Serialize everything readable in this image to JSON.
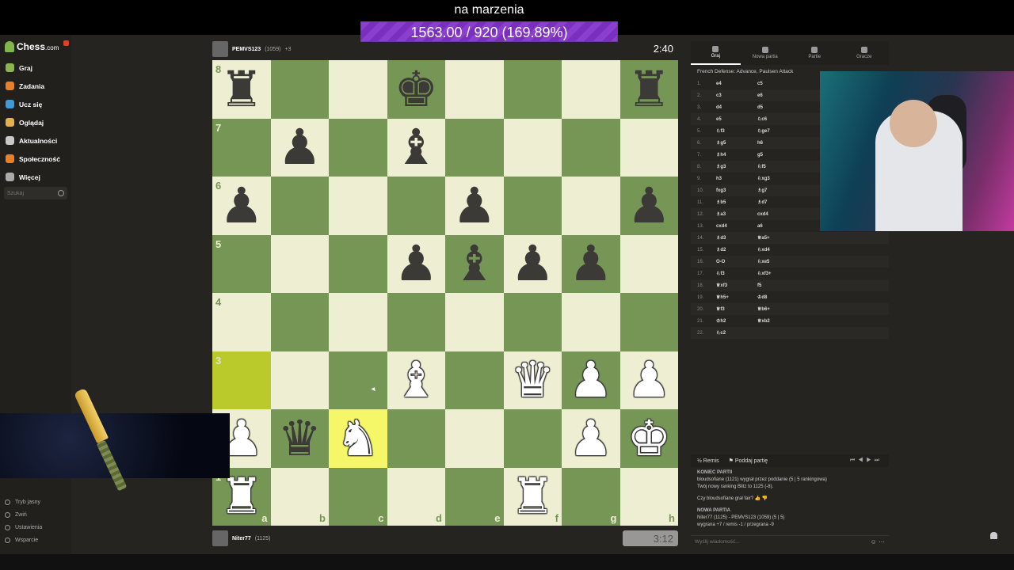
{
  "overlay": {
    "title": "na marzenia",
    "progress_text": "1563.00 / 920 (169.89%)",
    "progress_percent": 169.89
  },
  "sidebar": {
    "logo": "Chess",
    "logo_suffix": ".com",
    "items": [
      {
        "label": "Graj",
        "icon": "pawn-icon",
        "color": "#8bb34e"
      },
      {
        "label": "Zadania",
        "icon": "puzzle-icon",
        "color": "#e8802a"
      },
      {
        "label": "Ucz się",
        "icon": "graduation-cap-icon",
        "color": "#3f9ad8"
      },
      {
        "label": "Oglądaj",
        "icon": "tv-icon",
        "color": "#e8b04a"
      },
      {
        "label": "Aktualności",
        "icon": "news-icon",
        "color": "#c9c9c9"
      },
      {
        "label": "Społeczność",
        "icon": "community-icon",
        "color": "#e8802a"
      },
      {
        "label": "Więcej",
        "icon": "more-dots-icon",
        "color": "#aaaaaa"
      }
    ],
    "search_placeholder": "Szukaj",
    "bottom": [
      {
        "label": "Tryb jasny"
      },
      {
        "label": "Zwiń"
      },
      {
        "label": "Ustawienia"
      },
      {
        "label": "Wsparcie"
      }
    ]
  },
  "top_player": {
    "name": "PEMVS123",
    "rating": "(1059)",
    "clock": "2:40",
    "extra": "+3"
  },
  "bottom_player": {
    "name": "Niter77",
    "rating": "(1125)",
    "clock": "3:12"
  },
  "board": {
    "files": [
      "a",
      "b",
      "c",
      "d",
      "e",
      "f",
      "g",
      "h"
    ],
    "ranks": [
      "8",
      "7",
      "6",
      "5",
      "4",
      "3",
      "2",
      "1"
    ],
    "squares": [
      [
        "bR",
        "",
        "",
        "bK",
        "",
        "",
        "",
        "bR"
      ],
      [
        "",
        "bP",
        "",
        "bB",
        "",
        "",
        "",
        ""
      ],
      [
        "bP",
        "",
        "",
        "",
        "bP",
        "",
        "",
        "bP"
      ],
      [
        "",
        "",
        "",
        "bP",
        "bB",
        "bP",
        "bP",
        ""
      ],
      [
        "",
        "",
        "",
        "",
        "",
        "",
        "",
        ""
      ],
      [
        "",
        "",
        "",
        "wB",
        "",
        "wQ",
        "wP",
        "wP"
      ],
      [
        "wP",
        "bQ",
        "wN",
        "",
        "",
        "",
        "wP",
        "wK"
      ],
      [
        "wR",
        "",
        "",
        "",
        "",
        "wR",
        "",
        ""
      ]
    ],
    "highlights": [
      [
        5,
        0
      ],
      [
        6,
        2
      ]
    ]
  },
  "panel": {
    "tabs": [
      {
        "label": "Graj",
        "icon": "lightning-icon",
        "active": true
      },
      {
        "label": "Nowa partia",
        "icon": "plus-icon",
        "active": false
      },
      {
        "label": "Partie",
        "icon": "grid-icon",
        "active": false
      },
      {
        "label": "Gracze",
        "icon": "players-icon",
        "active": false
      }
    ],
    "opening": "French Defense: Advance, Paulsen Attack",
    "moves": [
      {
        "n": "1.",
        "w": "e4",
        "b": "c5"
      },
      {
        "n": "2.",
        "w": "c3",
        "b": "e6"
      },
      {
        "n": "3.",
        "w": "d4",
        "b": "d5"
      },
      {
        "n": "4.",
        "w": "e5",
        "b": "♘c6"
      },
      {
        "n": "5.",
        "w": "♘f3",
        "b": "♘ge7"
      },
      {
        "n": "6.",
        "w": "♗g5",
        "b": "h6"
      },
      {
        "n": "7.",
        "w": "♗h4",
        "b": "g5"
      },
      {
        "n": "8.",
        "w": "♗g3",
        "b": "♘f5"
      },
      {
        "n": "9.",
        "w": "h3",
        "b": "♘xg3"
      },
      {
        "n": "10.",
        "w": "fxg3",
        "b": "♗g7"
      },
      {
        "n": "11.",
        "w": "♗b5",
        "b": "♗d7"
      },
      {
        "n": "12.",
        "w": "♗a3",
        "b": "cxd4"
      },
      {
        "n": "13.",
        "w": "cxd4",
        "b": "a6"
      },
      {
        "n": "14.",
        "w": "♗d3",
        "b": "♕a5+"
      },
      {
        "n": "15.",
        "w": "♗d2",
        "b": "♘xd4"
      },
      {
        "n": "16.",
        "w": "O-O",
        "b": "♘xe5"
      },
      {
        "n": "17.",
        "w": "♘f3",
        "b": "♘xf3+"
      },
      {
        "n": "18.",
        "w": "♕xf3",
        "b": "f5"
      },
      {
        "n": "19.",
        "w": "♕h5+",
        "b": "♔d8"
      },
      {
        "n": "20.",
        "w": "♕f3",
        "b": "♕b6+"
      },
      {
        "n": "21.",
        "w": "♔h2",
        "b": "♕xb2"
      },
      {
        "n": "22.",
        "w": "♘c2",
        "b": ""
      }
    ],
    "controls": {
      "draw": "Remis",
      "resign": "Poddaj partię"
    },
    "chat": {
      "game_over_head": "KONIEC PARTII",
      "game_over_line": "bloudsofiane (1121) wygrał przez poddanie (5 | 5 rankingowa)",
      "rating_line": "Twój nowy ranking Blitz to 1125 (-8).",
      "fair_question": "Czy bloudsofiane grał fair?",
      "new_game_head": "NOWA PARTIA",
      "new_game_line": "Niter77 (1125) - PEMVS123 (1059) (5 | 5)",
      "stats_line": "wygrana +7 / remis -1 / przegrana -9",
      "input_placeholder": "Wyślij wiadomość..."
    }
  }
}
